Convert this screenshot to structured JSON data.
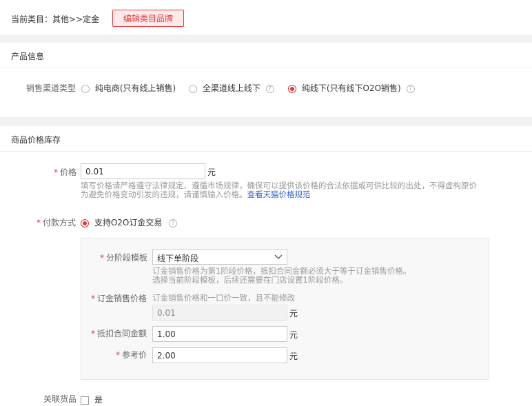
{
  "header": {
    "current_category_label": "当前类目：其他>>定金",
    "edit_button_label": "编辑类目品牌"
  },
  "product_info": {
    "section_title": "产品信息",
    "channel_label": "销售渠道类型",
    "options": [
      {
        "label": "纯电商(只有线上销售)",
        "selected": false,
        "help": false
      },
      {
        "label": "全渠道线上线下",
        "selected": false,
        "help": true
      },
      {
        "label": "纯线下(只有线下O2O销售)",
        "selected": true,
        "help": true
      }
    ],
    "help_glyph": "?"
  },
  "price_stock": {
    "section_title": "商品价格库存",
    "price": {
      "label": "价格",
      "value": "0.01",
      "unit": "元",
      "hint_line1": "填写价格请严格遵守法律规定、遵循市场规律，确保可以提供该价格的合法依据或可供比较的出处，不得虚构原价",
      "hint_line2": "为避免价格变动引发的违规，请谨慎输入价格。",
      "hint_link": "查看天猫价格规范"
    },
    "payment": {
      "label": "付款方式",
      "option_label": "支持O2O订金交易",
      "selected": true
    },
    "stage_box": {
      "template_label": "分阶段模板",
      "template_value": "线下单阶段",
      "template_hint_line1": "订金销售价格为第1阶段价格，抵扣合同金额必须大于等于订金销售价格。",
      "template_hint_line2": "选择当前阶段模板，后续还需要在门店设置1阶段价格。",
      "deposit_price_label": "订金销售价格",
      "deposit_price_hint": "订金销售价格和一口价一致，且不能修改",
      "deposit_price_value": "0.01",
      "deposit_price_unit": "元",
      "contract_amount_label": "抵扣合同金额",
      "contract_amount_value": "1.00",
      "contract_amount_unit": "元",
      "reference_price_label": "参考价",
      "reference_price_value": "2.00",
      "reference_price_unit": "元"
    },
    "related_goods": {
      "label": "关联货品",
      "option_label": "是"
    }
  },
  "colors": {
    "accent": "#e4393c",
    "link": "#3366cc",
    "button_bg": "#fdeaea"
  }
}
